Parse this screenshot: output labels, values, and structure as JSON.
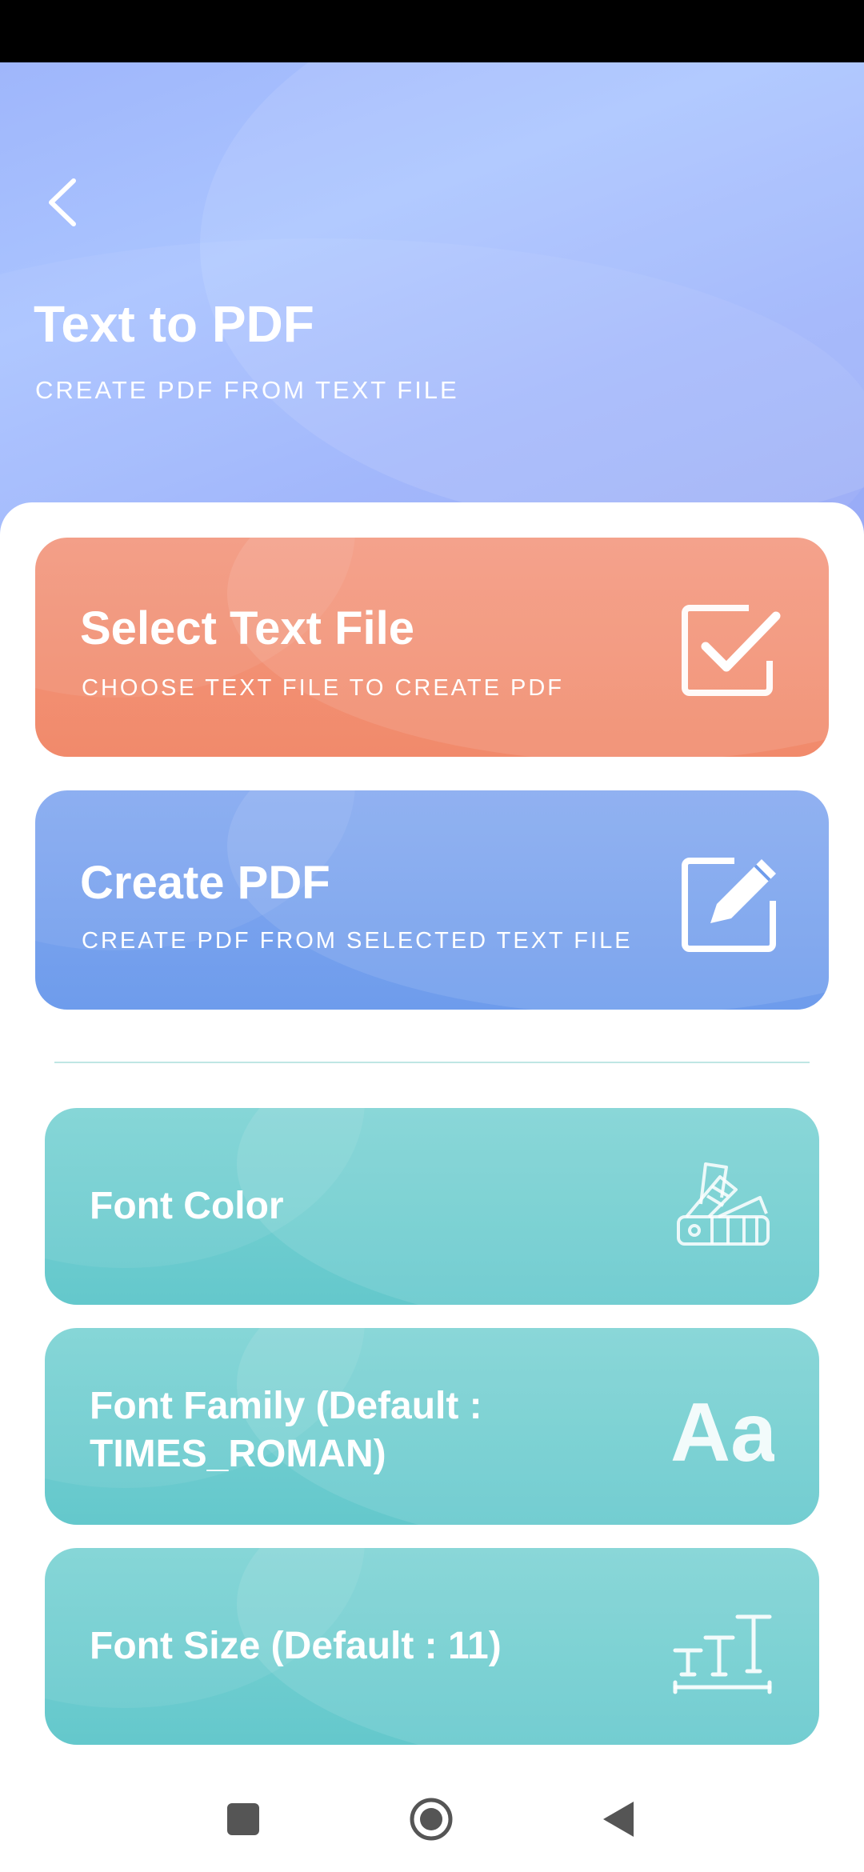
{
  "header": {
    "title": "Text to PDF",
    "subtitle": "CREATE PDF FROM TEXT FILE",
    "back_icon": "chevron-left-icon"
  },
  "actions": [
    {
      "title": "Select Text File",
      "subtitle": "CHOOSE TEXT FILE TO CREATE PDF",
      "icon": "checkbox-icon",
      "color": "#f18a6b"
    },
    {
      "title": "Create PDF",
      "subtitle": "CREATE PDF FROM SELECTED TEXT FILE",
      "icon": "edit-icon",
      "color": "#6e9cec"
    }
  ],
  "settings": [
    {
      "label": "Font Color",
      "icon": "color-swatch-icon"
    },
    {
      "label": "Font Family (Default : TIMES_ROMAN)",
      "icon": "font-family-icon",
      "icon_text": "Aa"
    },
    {
      "label": "Font Size (Default : 11)",
      "icon": "font-size-icon"
    }
  ],
  "colors": {
    "header": "#9fb6fb",
    "settings_card": "#64c8cc"
  },
  "nav": {
    "recent_icon": "square-icon",
    "home_icon": "circle-icon",
    "back_icon": "triangle-back-icon"
  }
}
